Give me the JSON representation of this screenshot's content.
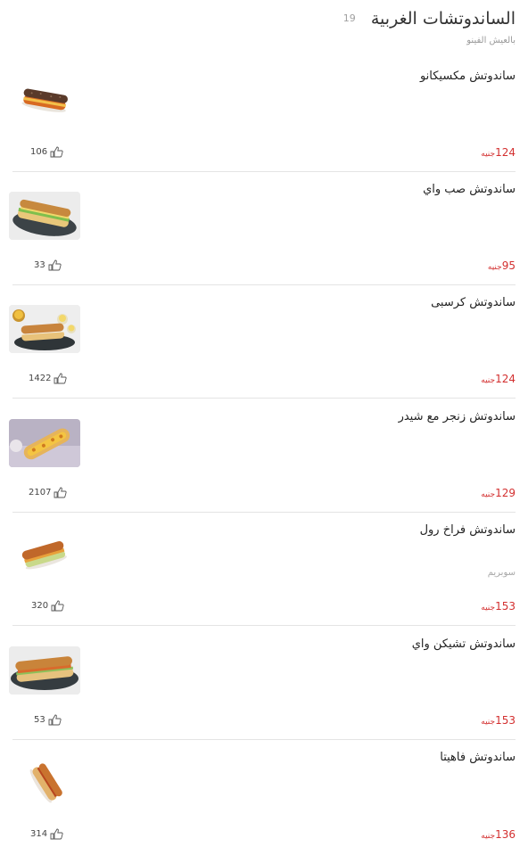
{
  "category": {
    "title": "الساندوتشات الغربية",
    "count": "19",
    "subtitle": "بالعيش الفينو"
  },
  "currency": "جنيه",
  "items": [
    {
      "name": "ساندوتش مكسيكانو",
      "description": "",
      "price": "124",
      "likes": "106",
      "image_icon": "mexicano-sandwich-image"
    },
    {
      "name": "ساندوتش صب واي",
      "description": "",
      "price": "95",
      "likes": "33",
      "image_icon": "sub-way-sandwich-image"
    },
    {
      "name": "ساندوتش كرسبى",
      "description": "",
      "price": "124",
      "likes": "1422",
      "image_icon": "crispy-sandwich-image"
    },
    {
      "name": "ساندوتش زنجر مع شيدر",
      "description": "",
      "price": "129",
      "likes": "2107",
      "image_icon": "zinger-cheddar-sandwich-image"
    },
    {
      "name": "ساندوتش فراخ رول",
      "description": "سوبريم",
      "price": "153",
      "likes": "320",
      "image_icon": "chicken-roll-sandwich-image"
    },
    {
      "name": "ساندوتش تشيكن واي",
      "description": "",
      "price": "153",
      "likes": "53",
      "image_icon": "chicken-way-sandwich-image"
    },
    {
      "name": "ساندوتش فاهيتا",
      "description": "",
      "price": "136",
      "likes": "314",
      "image_icon": "fajita-sandwich-image"
    }
  ],
  "colors": {
    "price": "#d32f2f",
    "divider": "#e4e4e4",
    "muted": "#9a9a9a"
  },
  "icons": {
    "like": "thumbs-up-icon"
  }
}
